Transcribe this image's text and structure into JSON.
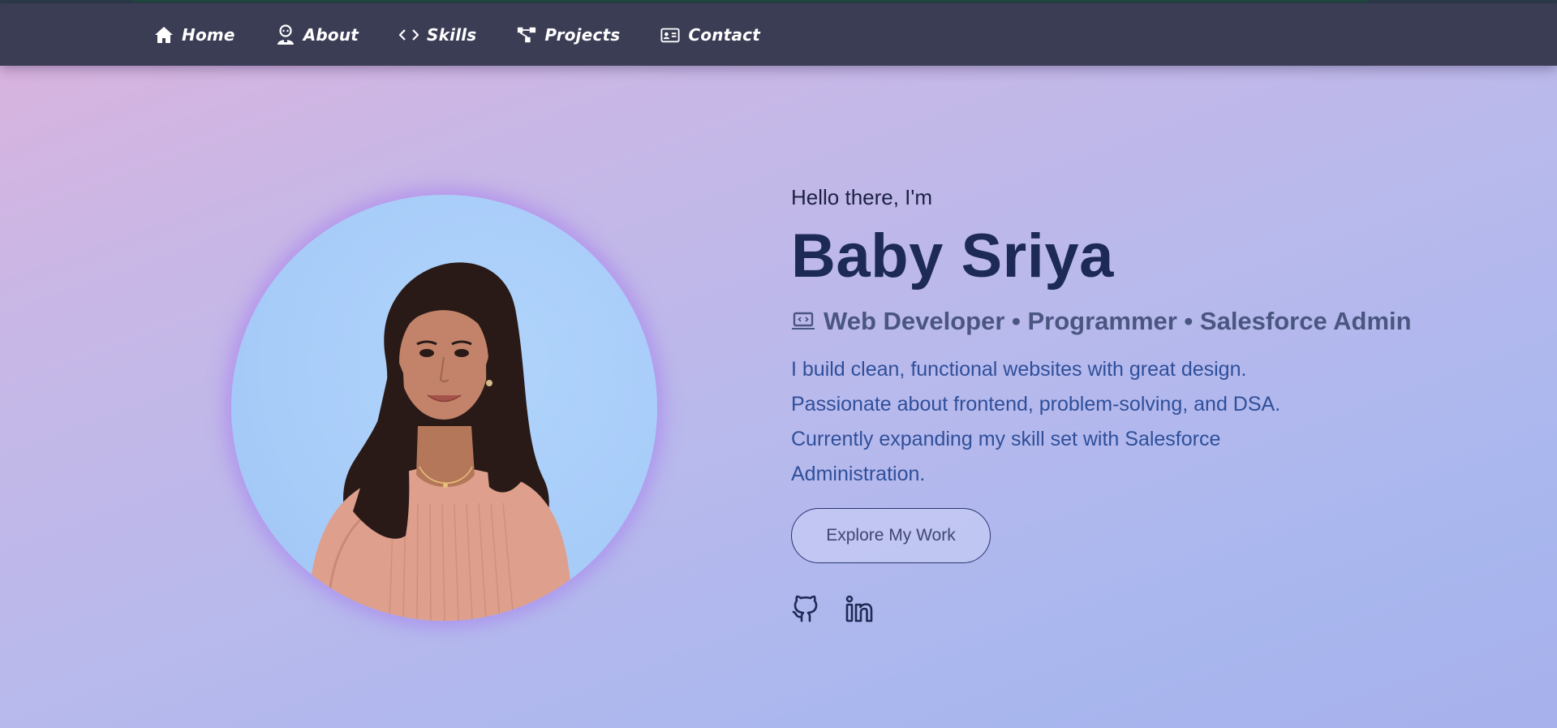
{
  "nav": {
    "items": [
      {
        "label": "Home",
        "icon": "home-icon"
      },
      {
        "label": "About",
        "icon": "user-icon"
      },
      {
        "label": "Skills",
        "icon": "code-icon"
      },
      {
        "label": "Projects",
        "icon": "diagram-icon"
      },
      {
        "label": "Contact",
        "icon": "contact-card-icon"
      }
    ]
  },
  "hero": {
    "greeting": "Hello there, I'm",
    "name": "Baby Sriya",
    "role_icon": "laptop-code-icon",
    "role": "Web Developer • Programmer • Salesforce Admin",
    "bio": [
      "I build clean, functional websites with great design.",
      "Passionate about frontend, problem-solving, and DSA.",
      "Currently expanding my skill set with Salesforce",
      "Administration."
    ],
    "cta_label": "Explore My Work",
    "socials": [
      {
        "icon": "github-icon"
      },
      {
        "icon": "linkedin-icon"
      }
    ],
    "photo": "profile-photo"
  },
  "colors": {
    "navbar": "#3b3d55",
    "name": "#1c2a55",
    "role": "#4a5680",
    "bio": "#2f4f9a"
  }
}
